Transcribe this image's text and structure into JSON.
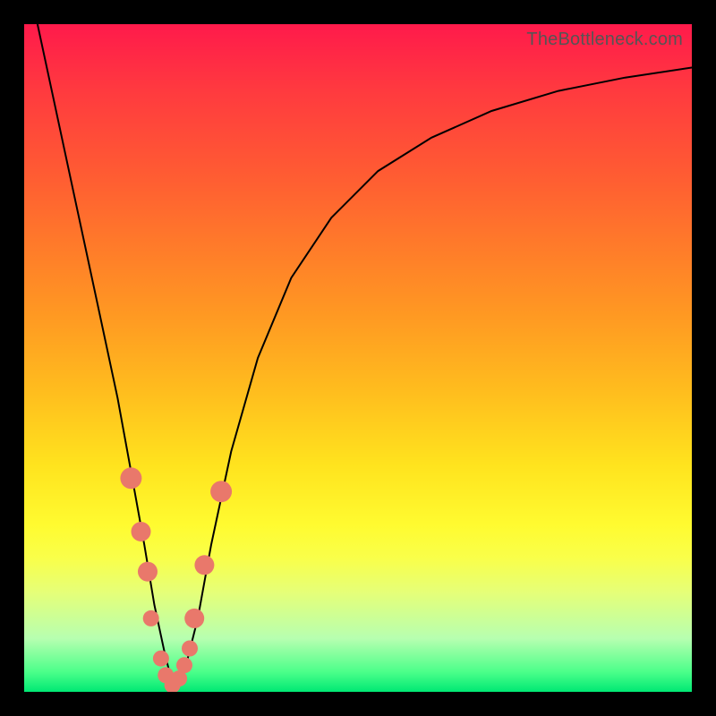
{
  "watermark": "TheBottleneck.com",
  "colors": {
    "frame": "#000000",
    "curve": "#000000",
    "marker": "#e9786b",
    "gradient_top": "#ff1a4b",
    "gradient_bottom": "#00e874"
  },
  "chart_data": {
    "type": "line",
    "title": "",
    "xlabel": "",
    "ylabel": "",
    "xlim": [
      0,
      100
    ],
    "ylim": [
      0,
      100
    ],
    "annotations": [
      "TheBottleneck.com"
    ],
    "series": [
      {
        "name": "bottleneck-curve",
        "x": [
          2,
          5,
          8,
          11,
          14,
          16,
          18,
          19.5,
          21,
          22,
          23,
          24,
          26,
          28,
          31,
          35,
          40,
          46,
          53,
          61,
          70,
          80,
          90,
          100
        ],
        "y": [
          100,
          86,
          72,
          58,
          44,
          33,
          22,
          13,
          6,
          2,
          0.5,
          3,
          11,
          22,
          36,
          50,
          62,
          71,
          78,
          83,
          87,
          90,
          92,
          93.5
        ]
      }
    ],
    "markers": {
      "name": "highlight-points",
      "points": [
        {
          "x": 16.0,
          "y": 32.0
        },
        {
          "x": 17.5,
          "y": 24.0
        },
        {
          "x": 18.5,
          "y": 18.0
        },
        {
          "x": 19.0,
          "y": 11.0
        },
        {
          "x": 20.5,
          "y": 5.0
        },
        {
          "x": 21.2,
          "y": 2.5
        },
        {
          "x": 22.2,
          "y": 1.0
        },
        {
          "x": 23.2,
          "y": 2.0
        },
        {
          "x": 24.0,
          "y": 4.0
        },
        {
          "x": 24.8,
          "y": 6.5
        },
        {
          "x": 25.5,
          "y": 11.0
        },
        {
          "x": 27.0,
          "y": 19.0
        },
        {
          "x": 29.5,
          "y": 30.0
        }
      ]
    }
  }
}
